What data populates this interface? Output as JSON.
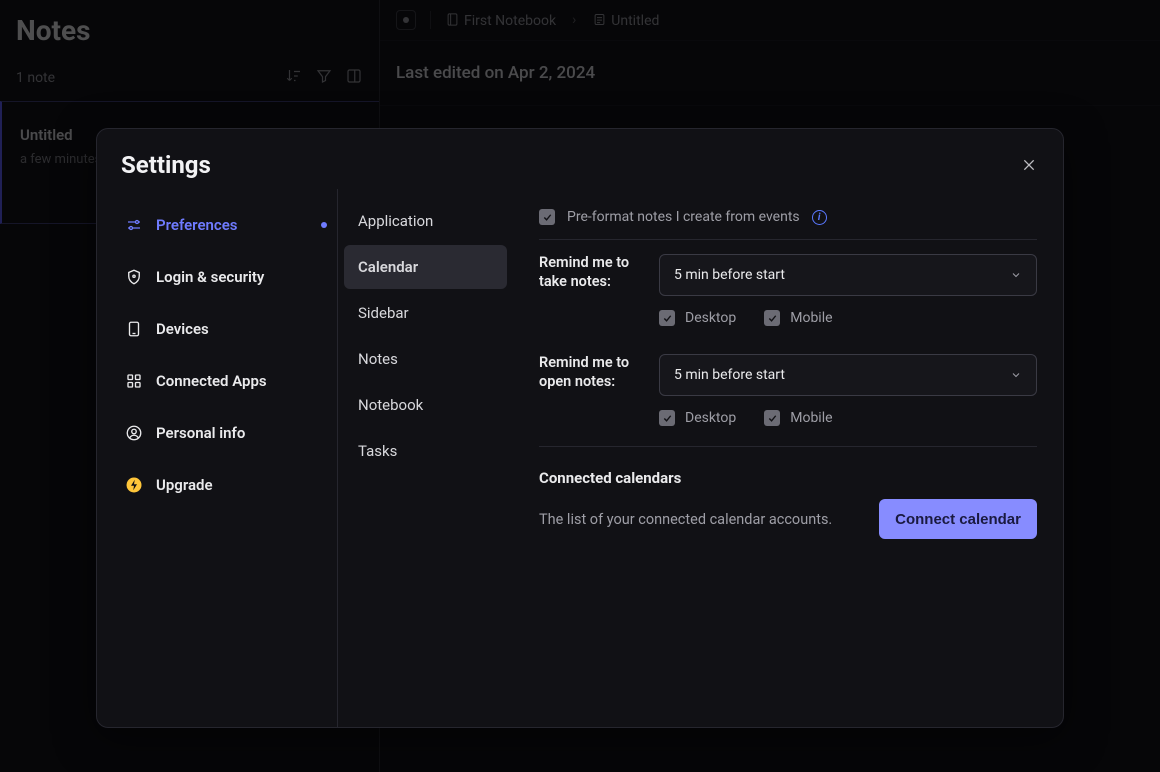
{
  "app": {
    "sidebar_title": "Notes",
    "note_count": "1 note",
    "note_card": {
      "title": "Untitled",
      "subtitle": "a few minutes ago"
    },
    "breadcrumb": {
      "notebook": "First Notebook",
      "note": "Untitled"
    },
    "last_edited": "Last edited on Apr 2, 2024"
  },
  "modal": {
    "title": "Settings",
    "nav": [
      {
        "label": "Preferences",
        "active": true
      },
      {
        "label": "Login & security"
      },
      {
        "label": "Devices"
      },
      {
        "label": "Connected Apps"
      },
      {
        "label": "Personal info"
      },
      {
        "label": "Upgrade",
        "upgrade": true
      }
    ],
    "subnav": [
      {
        "label": "Application"
      },
      {
        "label": "Calendar",
        "active": true
      },
      {
        "label": "Sidebar"
      },
      {
        "label": "Notes"
      },
      {
        "label": "Notebook"
      },
      {
        "label": "Tasks"
      }
    ],
    "panel": {
      "preformat_label": "Pre-format notes I create from events",
      "remind_take": {
        "label": "Remind me to take notes:",
        "value": "5 min before start",
        "desktop_label": "Desktop",
        "mobile_label": "Mobile"
      },
      "remind_open": {
        "label": "Remind me to open notes:",
        "value": "5 min before start",
        "desktop_label": "Desktop",
        "mobile_label": "Mobile"
      },
      "connected_title": "Connected calendars",
      "connected_desc": "The list of your connected calendar accounts.",
      "connect_btn": "Connect calendar"
    }
  }
}
